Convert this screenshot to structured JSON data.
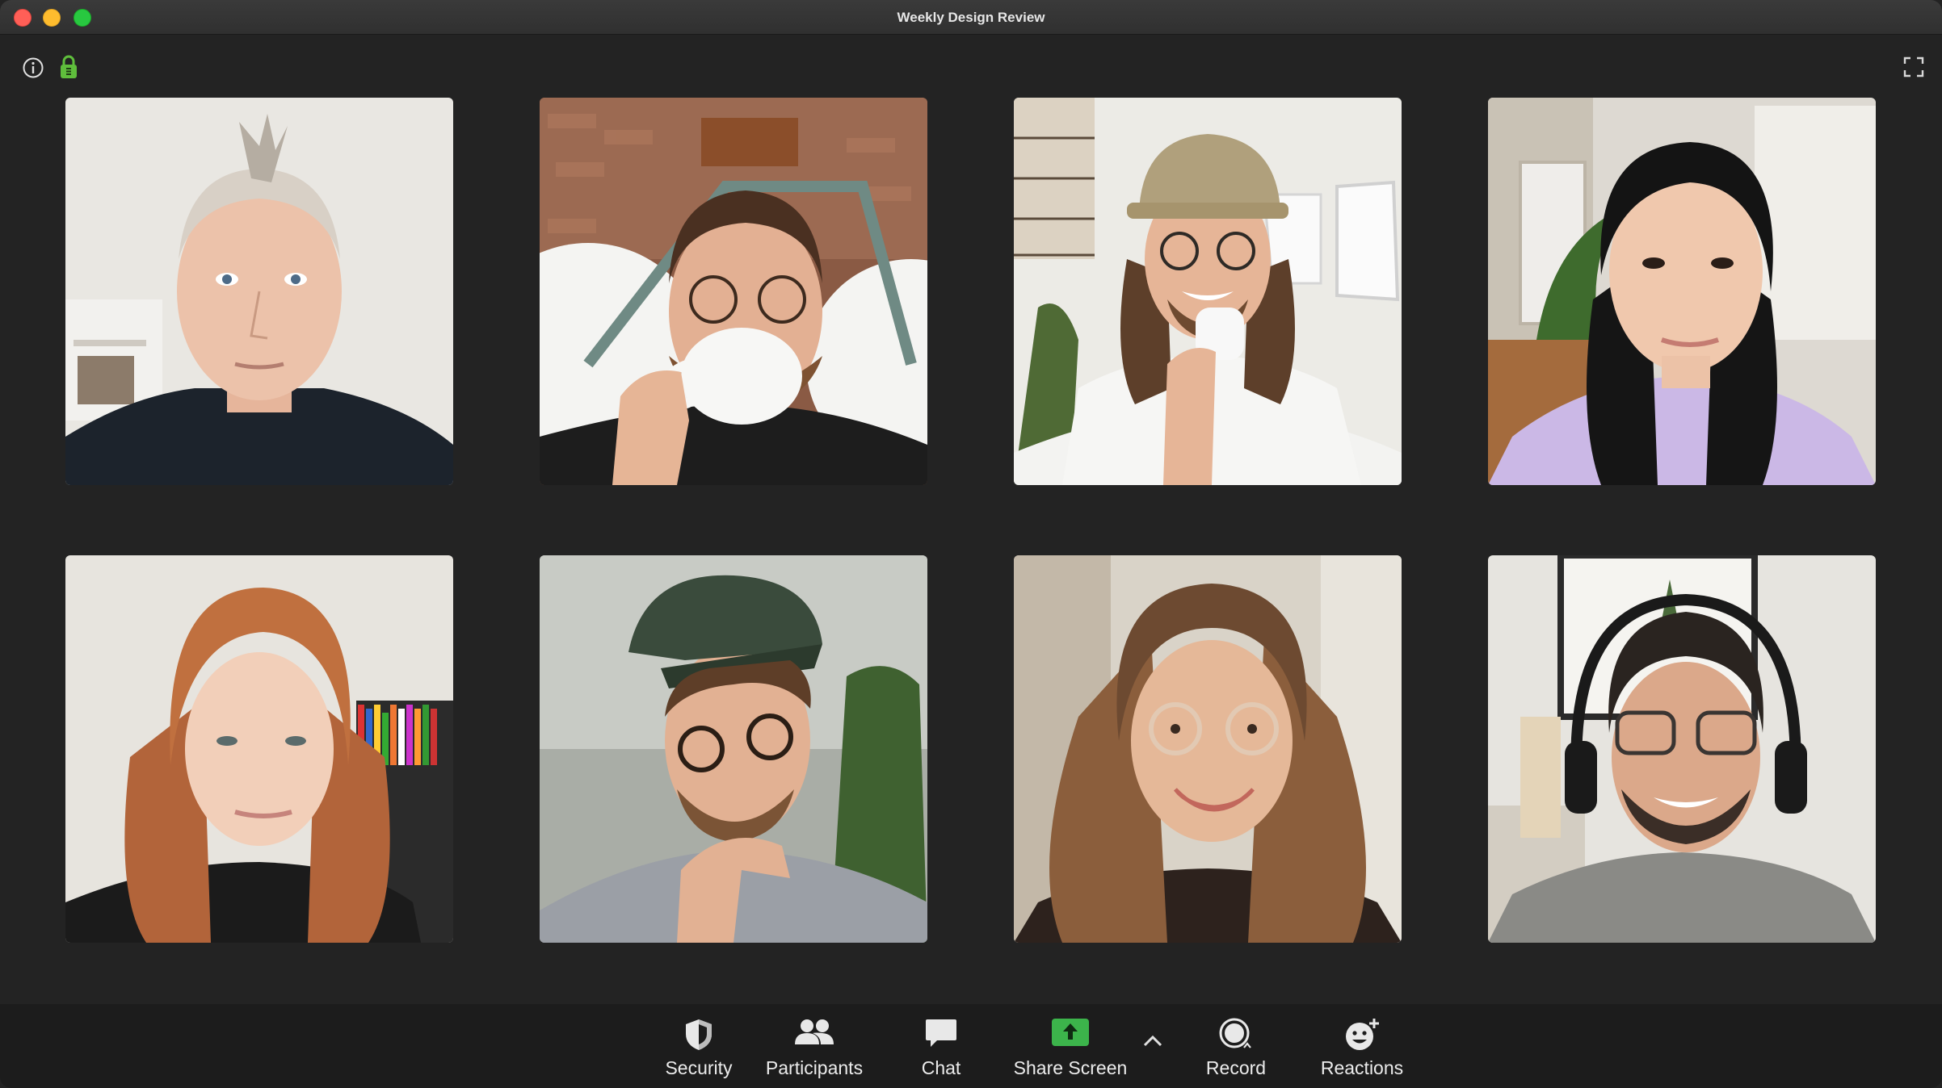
{
  "window": {
    "title": "Weekly Design Review"
  },
  "top_icons": {
    "info": "info-icon",
    "lock": "lock-icon",
    "fullscreen": "fullscreen-icon"
  },
  "participants_grid": {
    "columns": 4,
    "rows": 2,
    "tiles": [
      {
        "description": "participant-video",
        "bg": "#e9e7e2"
      },
      {
        "description": "participant-video",
        "bg": "#8a5a44"
      },
      {
        "description": "participant-video",
        "bg": "#ecebe6"
      },
      {
        "description": "participant-video",
        "bg": "#ddd9d2"
      },
      {
        "description": "participant-video",
        "bg": "#e7e4de"
      },
      {
        "description": "participant-video",
        "bg": "#a9ada6"
      },
      {
        "description": "participant-video",
        "bg": "#d9d3c8"
      },
      {
        "description": "participant-video",
        "bg": "#e6e4df"
      }
    ]
  },
  "toolbar": {
    "security_label": "Security",
    "participants_label": "Participants",
    "chat_label": "Chat",
    "share_screen_label": "Share Screen",
    "record_label": "Record",
    "reactions_label": "Reactions"
  },
  "colors": {
    "background": "#232323",
    "toolbar": "#1c1c1c",
    "share_green": "#3cb44b",
    "lock_green": "#5fbe3c",
    "text": "#ececec"
  }
}
